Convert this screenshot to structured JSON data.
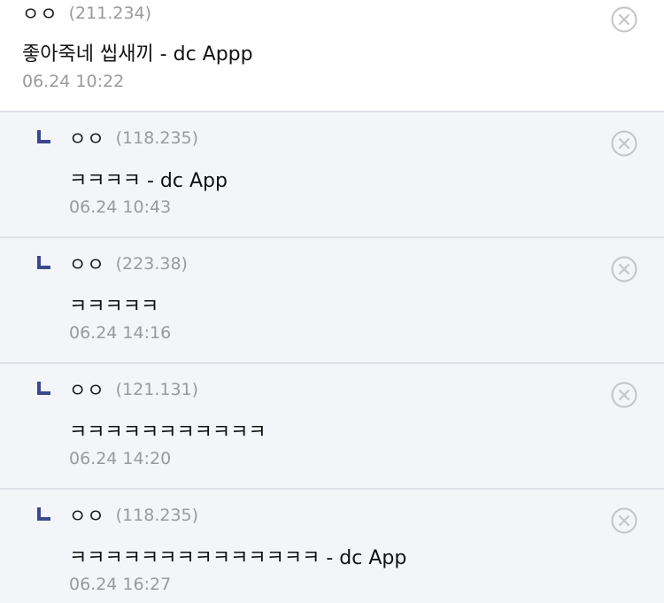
{
  "comments": [
    {
      "nick": "ㅇㅇ",
      "ip": "(211.234)",
      "body": "좋아죽네 씹새끼 - dc Appp",
      "date": "06.24 10:22",
      "is_reply": false
    },
    {
      "nick": "ㅇㅇ",
      "ip": "(118.235)",
      "body": "ㅋㅋㅋㅋ - dc App",
      "date": "06.24 10:43",
      "is_reply": true
    },
    {
      "nick": "ㅇㅇ",
      "ip": "(223.38)",
      "body": "ㅋㅋㅋㅋㅋ",
      "date": "06.24 14:16",
      "is_reply": true
    },
    {
      "nick": "ㅇㅇ",
      "ip": "(121.131)",
      "body": "ㅋㅋㅋㅋㅋㅋㅋㅋㅋㅋㅋ",
      "date": "06.24 14:20",
      "is_reply": true
    },
    {
      "nick": "ㅇㅇ",
      "ip": "(118.235)",
      "body": "ㅋㅋㅋㅋㅋㅋㅋㅋㅋㅋㅋㅋㅋㅋ - dc App",
      "date": "06.24 16:27",
      "is_reply": true
    }
  ],
  "icons": {
    "reply": "reply-arrow-icon",
    "delete": "close-circle-icon"
  },
  "colors": {
    "reply_background": "#f4f5f9",
    "reply_mark": "#3b4890",
    "meta_text": "#9a9a9a",
    "divider": "#dfe1e8"
  }
}
